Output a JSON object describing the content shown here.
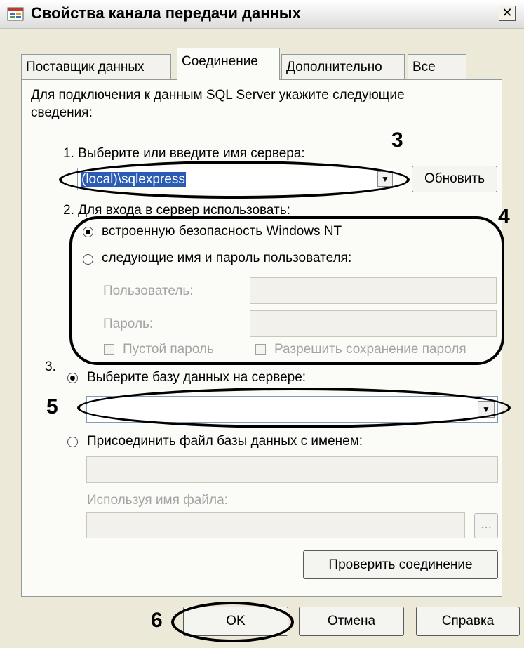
{
  "window": {
    "title": "Свойства канала передачи данных",
    "close_glyph": "✕"
  },
  "tabs": [
    {
      "label": "Поставщик данных",
      "active": false
    },
    {
      "label": "Соединение",
      "active": true
    },
    {
      "label": "Дополнительно",
      "active": false
    },
    {
      "label": "Все",
      "active": false
    }
  ],
  "intro": {
    "line1": "Для подключения к данным SQL Server укажите следующие",
    "line2": "сведения:"
  },
  "server": {
    "step_label": "1. Выберите или введите имя сервера:",
    "value": "(local)\\sqlexpress",
    "refresh_button": "Обновить"
  },
  "login": {
    "step_label": "2. Для входа в сервер использовать:",
    "option_windows": "встроенную безопасность Windows NT",
    "option_sql": "следующие имя и пароль пользователя:",
    "selected": "windows",
    "user_label": "Пользователь:",
    "user_value": "",
    "password_label": "Пароль:",
    "password_value": "",
    "blank_password": "Пустой пароль",
    "allow_saving": "Разрешить сохранение пароля"
  },
  "database": {
    "step_label": "3.",
    "option_select_db": "Выберите базу данных на сервере:",
    "db_value": "",
    "option_attach": "Присоединить файл базы данных с именем:",
    "attach_value": "",
    "logical_name_label": "Используя имя файла:",
    "logical_name_value": "",
    "browse_button": "...",
    "selected": "select_db"
  },
  "test_button": "Проверить соединение",
  "footer": {
    "ok": "OK",
    "cancel": "Отмена",
    "help": "Справка"
  },
  "annotations": [
    "3",
    "4",
    "5",
    "6"
  ],
  "colors": {
    "dialog_bg": "#ece9d8",
    "selection": "#2a5bb5",
    "field_border": "#7f9db9",
    "annotation": "#000000"
  }
}
